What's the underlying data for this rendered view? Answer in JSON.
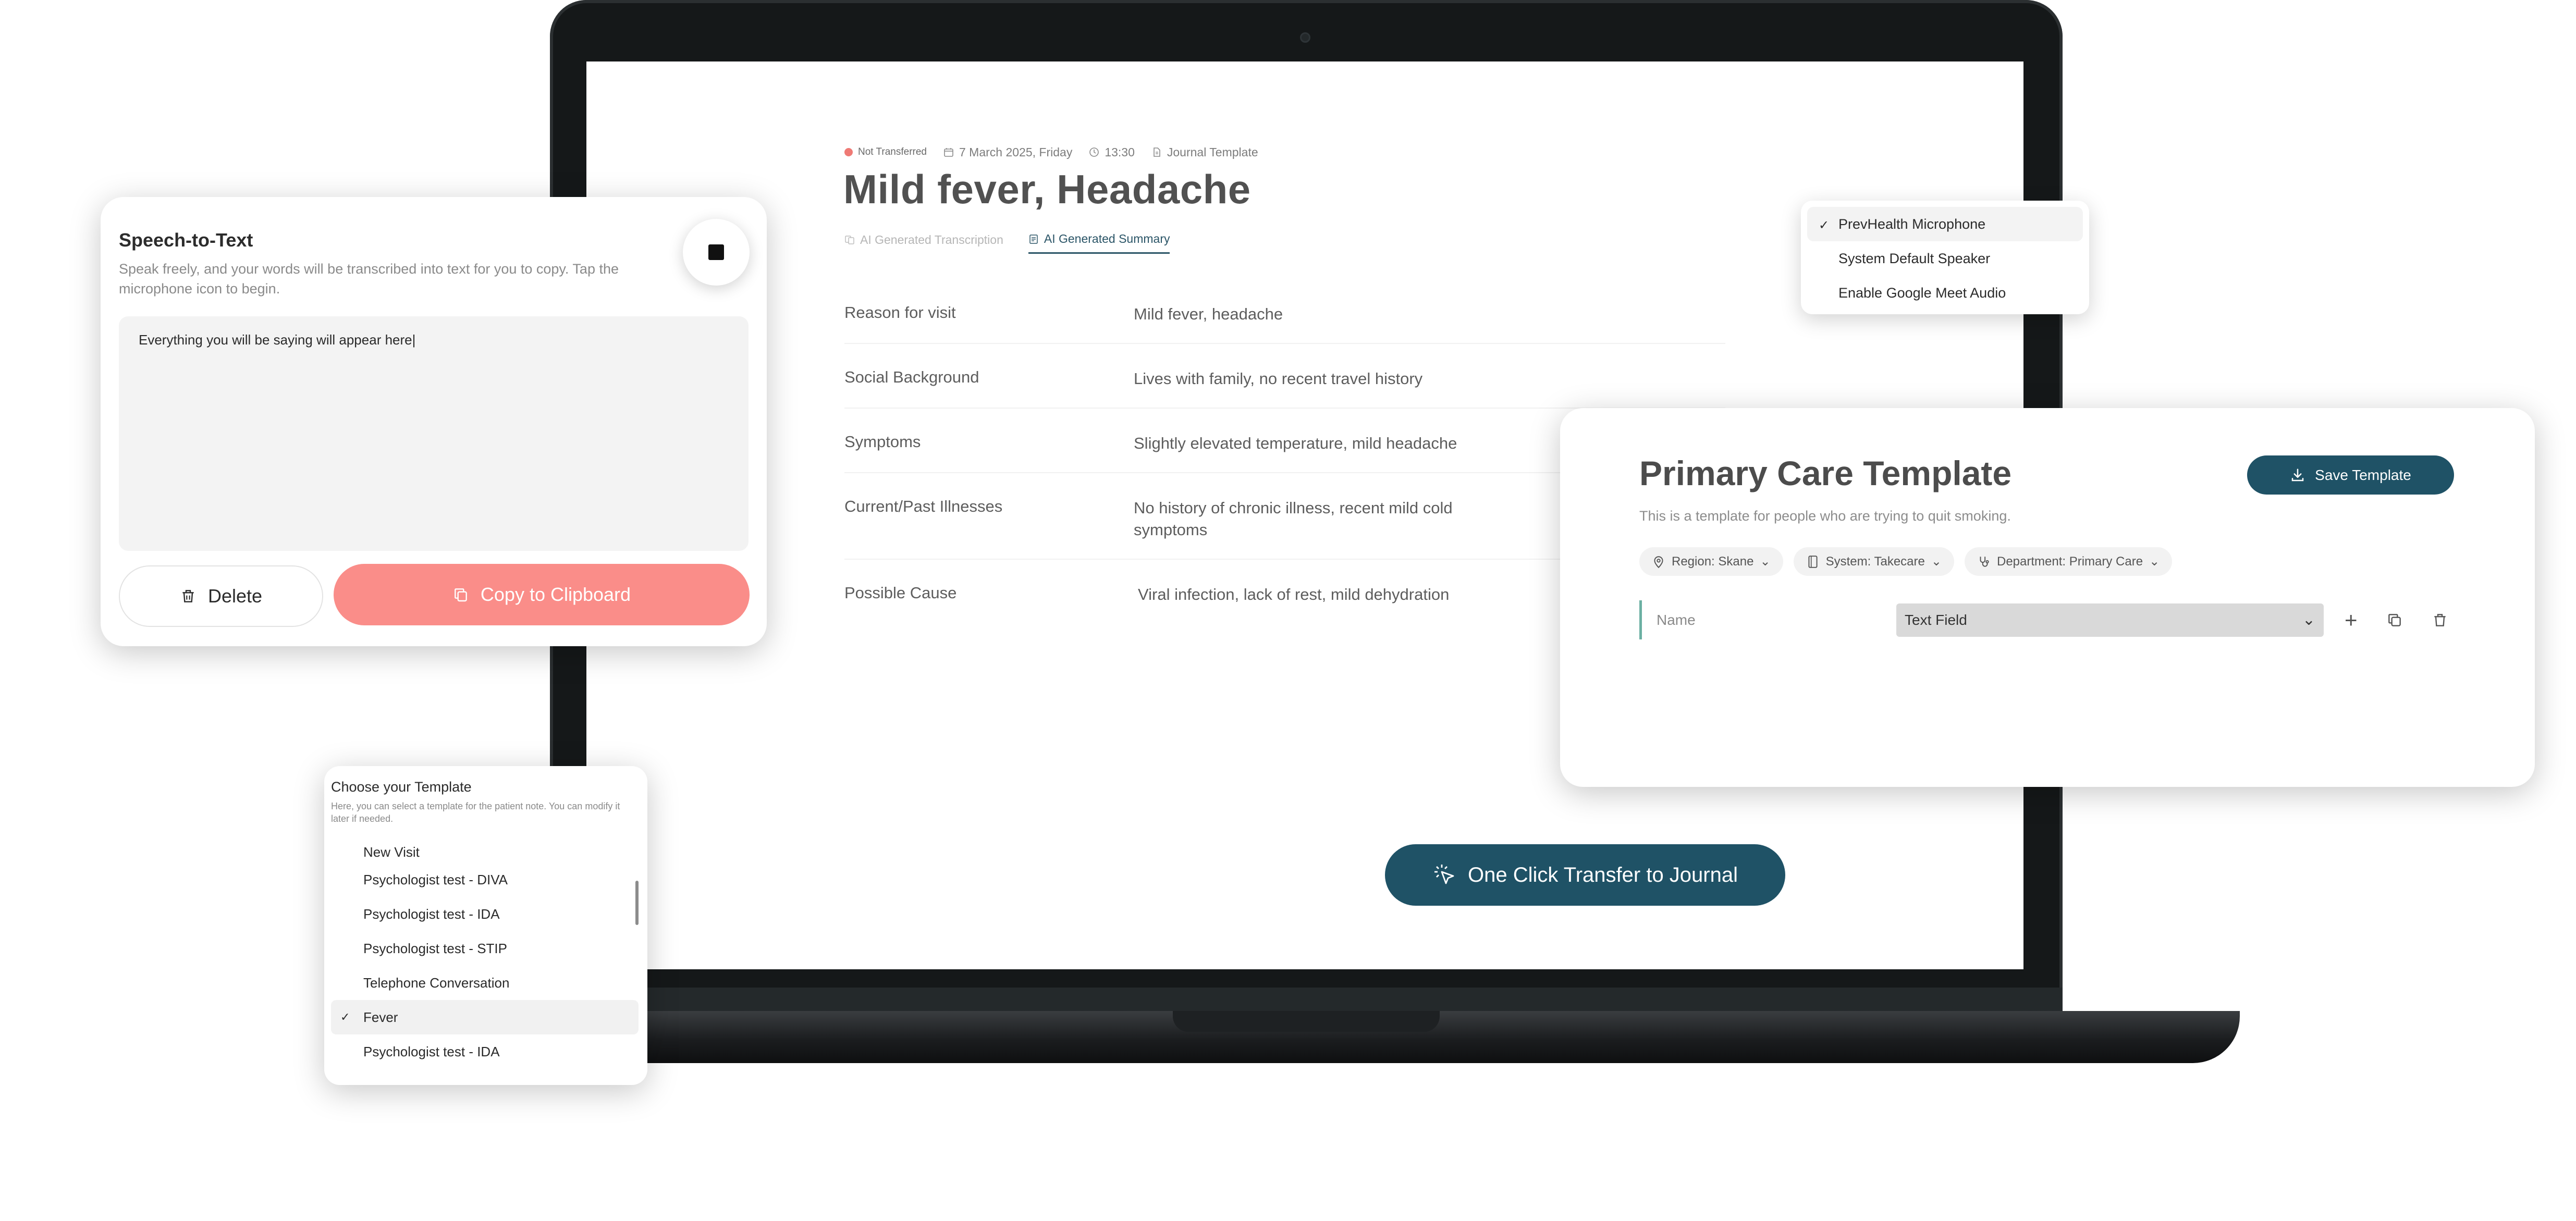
{
  "journal": {
    "status": "Not Transferred",
    "date": "7 March 2025, Friday",
    "time": "13:30",
    "template_name": "Journal Template",
    "title": "Mild fever, Headache",
    "tabs": [
      {
        "label": "AI Generated Transcription",
        "active": false
      },
      {
        "label": "AI Generated Summary",
        "active": true
      }
    ],
    "rows": [
      {
        "label": "Reason for visit",
        "value": "Mild fever, headache"
      },
      {
        "label": "Social Background",
        "value": "Lives with family, no recent travel history"
      },
      {
        "label": "Symptoms",
        "value": "Slightly elevated temperature, mild headache"
      },
      {
        "label": "Current/Past Illnesses",
        "value": "No history of chronic illness, recent mild cold symptoms"
      },
      {
        "label": "Possible Cause",
        "value": "Viral infection, lack of rest, mild dehydration"
      }
    ],
    "transfer_button": "One Click Transfer to Journal"
  },
  "mic_menu": {
    "items": [
      {
        "label": "PrevHealth Microphone",
        "selected": true
      },
      {
        "label": "System Default Speaker",
        "selected": false
      },
      {
        "label": "Enable Google Meet Audio",
        "selected": false
      }
    ]
  },
  "primary_care": {
    "title": "Primary Care Template",
    "subtitle": "This is a template for people who are trying to quit smoking.",
    "save_button": "Save Template",
    "filters": [
      {
        "label": "Region: Skane",
        "icon": "location-pin-icon"
      },
      {
        "label": "System: Takecare",
        "icon": "tablet-icon"
      },
      {
        "label": "Department: Primary Care",
        "icon": "stethoscope-icon"
      }
    ],
    "field": {
      "name": "Name",
      "type": "Text Field"
    }
  },
  "speech_to_text": {
    "title": "Speech-to-Text",
    "description": "Speak freely, and your words will be transcribed into text for you to copy. Tap the microphone icon to begin.",
    "placeholder_text": "Everything you will be saying will appear here|",
    "delete_button": "Delete",
    "copy_button": "Copy to Clipboard"
  },
  "template_chooser": {
    "title": "Choose your Template",
    "description": "Here, you can select a template for the patient note. You can modify it later if needed.",
    "items": [
      {
        "label": "New Visit",
        "selected": false
      },
      {
        "label": "Psychologist test - DIVA",
        "selected": false
      },
      {
        "label": "Psychologist test - IDA",
        "selected": false
      },
      {
        "label": "Psychologist test - STIP",
        "selected": false
      },
      {
        "label": "Telephone Conversation",
        "selected": false
      },
      {
        "label": "Fever",
        "selected": true
      },
      {
        "label": "Psychologist test - IDA",
        "selected": false
      }
    ]
  },
  "colors": {
    "primary": "#1f5266",
    "accent_coral": "#fa8d89",
    "status_red": "#ef7a75",
    "field_accent": "#6cb0a3"
  }
}
